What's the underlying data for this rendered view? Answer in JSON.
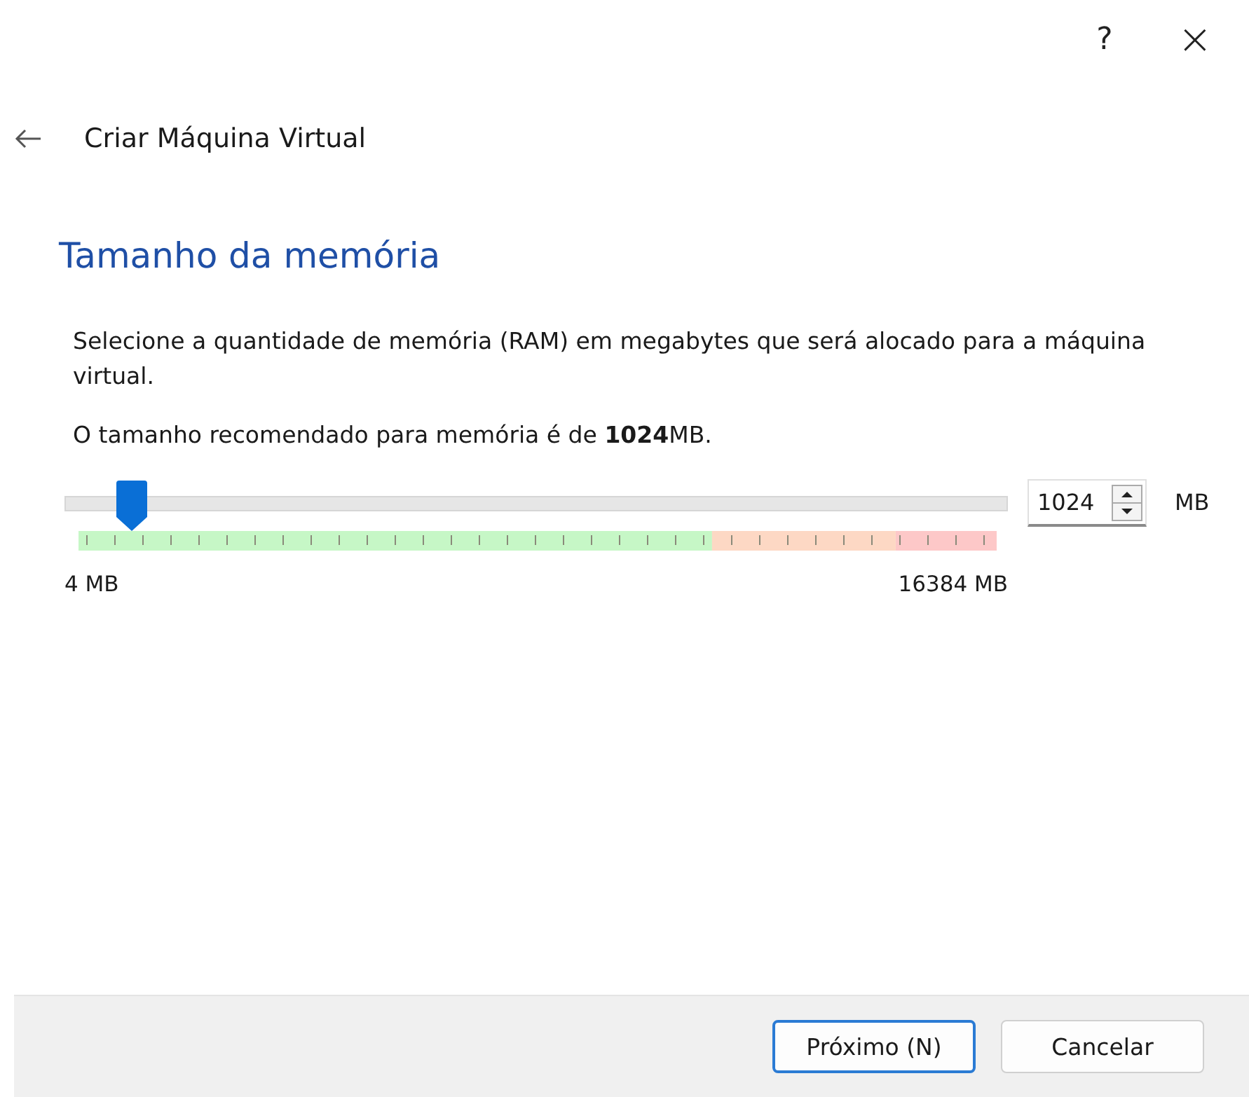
{
  "title_bar": {
    "help": "?",
    "close": "×"
  },
  "header": {
    "title": "Criar Máquina Virtual"
  },
  "page": {
    "heading": "Tamanho da memória",
    "description": "Selecione a quantidade de memória (RAM) em megabytes que será alocado para a máquina virtual.",
    "recommendation": "O tamanho recomendado para memória é de **1024**MB.",
    "slider": {
      "level": 0.07,
      "min_label": "4 MB",
      "max_label": "16384 MB",
      "zones": [
        {
          "color": "#c6f7c6"
        },
        {
          "color": "#fdd8c4"
        },
        {
          "color": "#fdc8c8"
        }
      ]
    },
    "spinbox": {
      "value": "1024",
      "unit": "MB"
    }
  },
  "buttons": [
    {
      "label": "Próximo (N)",
      "default": true
    },
    {
      "label": "Cancelar",
      "default": false
    }
  ]
}
